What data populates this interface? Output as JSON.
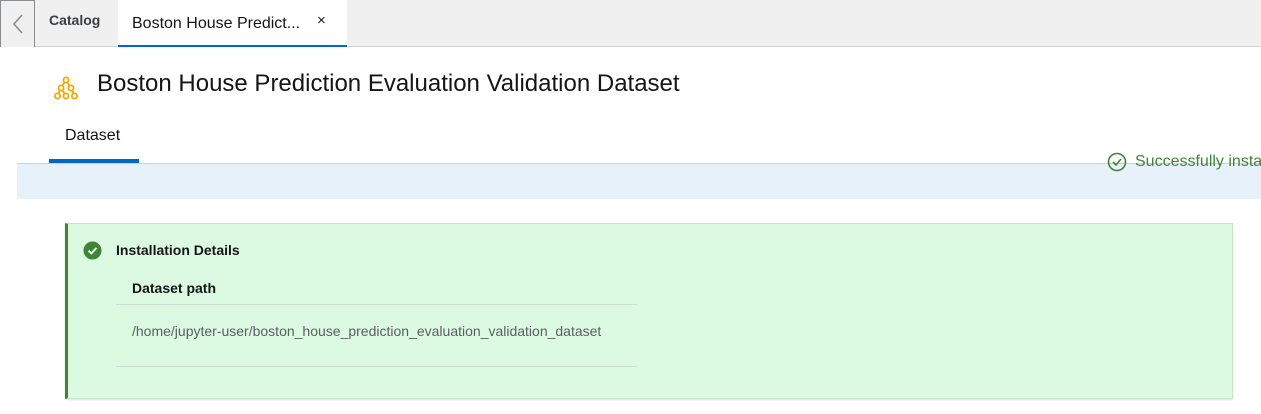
{
  "tabs": {
    "catalog_label": "Catalog",
    "active_label": "Boston House Predict...",
    "close_symbol": "×"
  },
  "page": {
    "title": "Boston House Prediction Evaluation Validation Dataset",
    "icon": "dataset-icon",
    "accent_color": "#f0ab00"
  },
  "section_tabs": {
    "active": "Dataset"
  },
  "status": {
    "text": "Successfully installed",
    "color": "#3e8635"
  },
  "alert": {
    "title": "Installation Details",
    "dataset_path_label": "Dataset path",
    "dataset_path_value": "/home/jupyter-user/boston_house_prediction_evaluation_validation_dataset",
    "background": "#dcf9e2"
  }
}
